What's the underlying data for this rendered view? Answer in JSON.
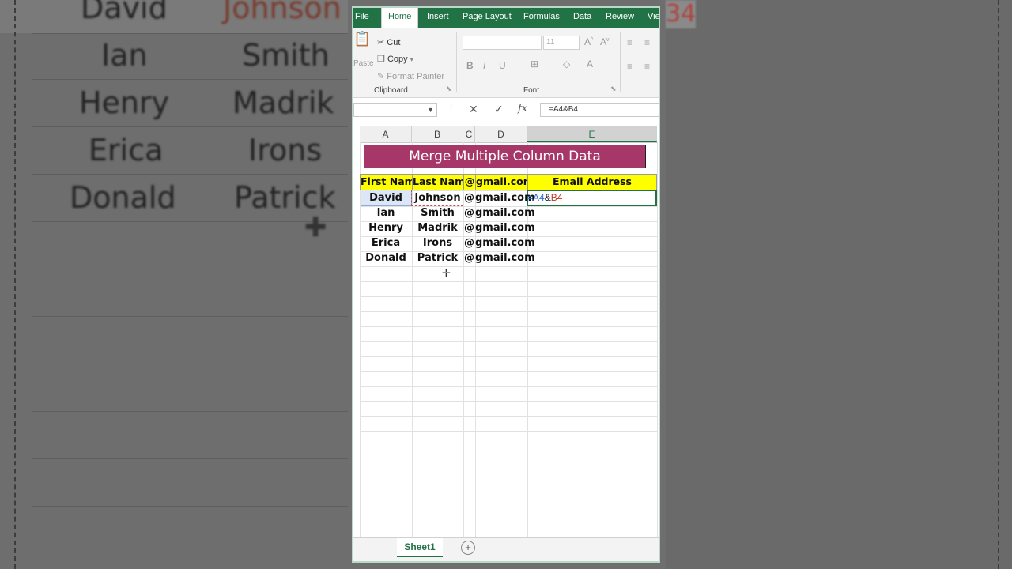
{
  "background": {
    "rows": [
      {
        "first": "David",
        "last": "Johnson"
      },
      {
        "first": "Ian",
        "last": "Smith"
      },
      {
        "first": "Henry",
        "last": "Madrik"
      },
      {
        "first": "Erica",
        "last": "Irons"
      },
      {
        "first": "Donald",
        "last": "Patrick"
      }
    ],
    "right_fragment": "34"
  },
  "ribbon": {
    "tabs": [
      "File",
      "Home",
      "Insert",
      "Page Layout",
      "Formulas",
      "Data",
      "Review",
      "View"
    ],
    "active_tab": "Home",
    "clipboard": {
      "cut": "Cut",
      "copy": "Copy",
      "format_painter": "Format Painter",
      "paste": "Paste",
      "label": "Clipboard"
    },
    "font": {
      "size": "11",
      "label": "Font",
      "bold": "B",
      "italic": "I",
      "underline": "U"
    }
  },
  "formula_bar": {
    "name_box": "",
    "cancel": "✕",
    "enter": "✓",
    "fx": "fx",
    "value": "=A4&B4"
  },
  "grid": {
    "columns": [
      "A",
      "B",
      "C",
      "D",
      "E"
    ],
    "selected_column": "E",
    "title": "Merge Multiple Column Data",
    "headers": [
      "First Name",
      "Last Name",
      "@",
      "gmail.com",
      "Email Address"
    ],
    "rows": [
      [
        "David",
        "Johnson",
        "@",
        "gmail.com"
      ],
      [
        "Ian",
        "Smith",
        "@",
        "gmail.com"
      ],
      [
        "Henry",
        "Madrik",
        "@",
        "gmail.com"
      ],
      [
        "Erica",
        "Irons",
        "@",
        "gmail.com"
      ],
      [
        "Donald",
        "Patrick",
        "@",
        "gmail.com"
      ]
    ],
    "editing_cell": {
      "ref1": "A4",
      "op": "&",
      "ref2": "B4",
      "eq": "="
    }
  },
  "sheets": {
    "tabs": [
      "Sheet1"
    ],
    "add": "+"
  },
  "colors": {
    "excel_green": "#217346",
    "title_fill": "#a63768",
    "header_fill": "#ffff00"
  }
}
